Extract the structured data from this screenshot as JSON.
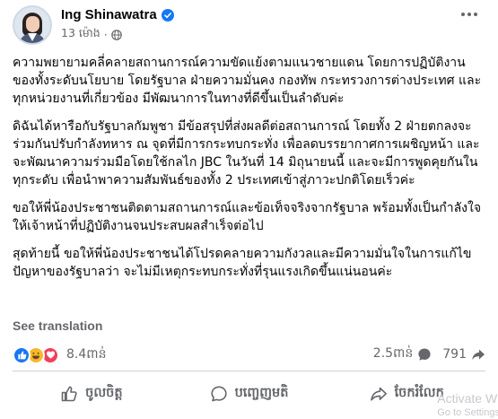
{
  "post": {
    "author": {
      "name": "Ing Shinawatra",
      "verified": true,
      "timestamp": "13 ម៉ោង",
      "privacy_icon": "globe-icon"
    },
    "paragraphs": [
      "ความพยายามคลี่คลายสถานการณ์ความขัดแย้งตามแนวชายแดน โดยการปฏิบัติงานของทั้งระดับนโยบาย โดยรัฐบาล ฝ่ายความมั่นคง กองทัพ กระทรวงการต่างประเทศ และทุกหน่วยงานที่เกี่ยวข้อง มีพัฒนาการในทางที่ดีขึ้นเป็นลำดับค่ะ",
      "ดิฉันได้หารือกับรัฐบาลกัมพูชา มีข้อสรุปที่ส่งผลดีต่อสถานการณ์ โดยทั้ง 2 ฝ่ายตกลงจะร่วมกันปรับกำลังทหาร ณ จุดที่มีการกระทบกระทั่ง เพื่อลดบรรยากาศการเผชิญหน้า และจะพัฒนาความร่วมมือโดยใช้กลไก JBC ในวันที่ 14 มิถุนายนนี้ และจะมีการพูดคุยกันในทุกระดับ เพื่อนำพาความสัมพันธ์ของทั้ง 2 ประเทศเข้าสู่ภาวะปกติโดยเร็วค่ะ",
      "ขอให้พี่น้องประชาชนติดตามสถานการณ์และข้อเท็จจริงจากรัฐบาล พร้อมทั้งเป็นกำลังใจให้เจ้าหน้าที่ปฏิบัติงานจนประสบผลสำเร็จต่อไป",
      "สุดท้ายนี้ ขอให้พี่น้องประชาชนได้โปรดคลายความกังวลและมีความมั่นใจในการแก้ไขปัญหาของรัฐบาลว่า จะไม่มีเหตุกระทบกระทั่งที่รุนแรงเกิดขึ้นแน่นอนค่ะ"
    ],
    "see_translation": "See translation"
  },
  "stats": {
    "reaction_icons": [
      "like-icon",
      "haha-icon",
      "love-icon"
    ],
    "reaction_count": "8.4ពាន់",
    "comments": "2.5ពាន់",
    "shares": "791"
  },
  "actions": {
    "like": "ចូលចិត្ត",
    "comment": "បញ្ចេញមតិ",
    "share": "ចែករំលែក"
  },
  "colors": {
    "accent": "#1877f2",
    "secondary_text": "#65676b",
    "love": "#f33e58",
    "haha": "#f7b928"
  },
  "watermark": {
    "title": "Activate W",
    "subtitle": "Go to Settings"
  }
}
